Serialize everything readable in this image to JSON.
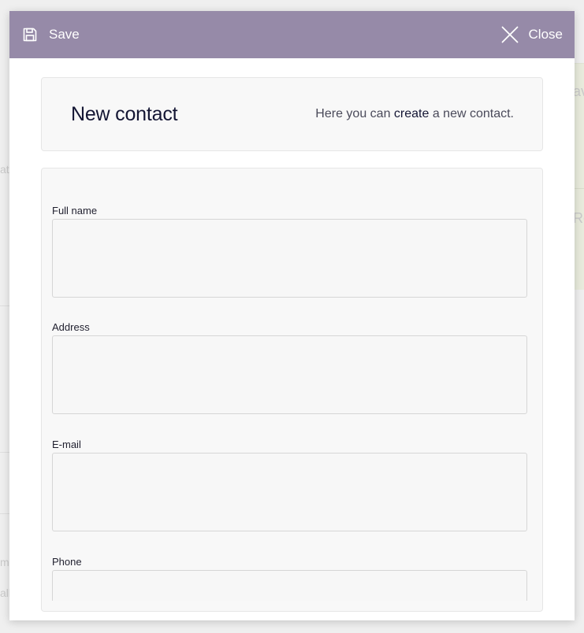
{
  "toolbar": {
    "save_label": "Save",
    "save_icon": "floppy-disk-icon",
    "close_label": "Close",
    "close_icon": "close-x-icon",
    "background_color": "#968aa8"
  },
  "header": {
    "title": "New contact",
    "subtitle_before": "Here you can ",
    "subtitle_emphasis": "create",
    "subtitle_after": " a new contact."
  },
  "form": {
    "fields": [
      {
        "label": "Full name",
        "value": "",
        "placeholder": ""
      },
      {
        "label": "Address",
        "value": "",
        "placeholder": ""
      },
      {
        "label": "E-mail",
        "value": "",
        "placeholder": ""
      },
      {
        "label": "Phone",
        "value": "",
        "placeholder": ""
      }
    ]
  },
  "background_fragments": {
    "top_right": "av",
    "middle_right": "Re",
    "left_1": "ati",
    "left_2": "me",
    "left_3": "all"
  }
}
